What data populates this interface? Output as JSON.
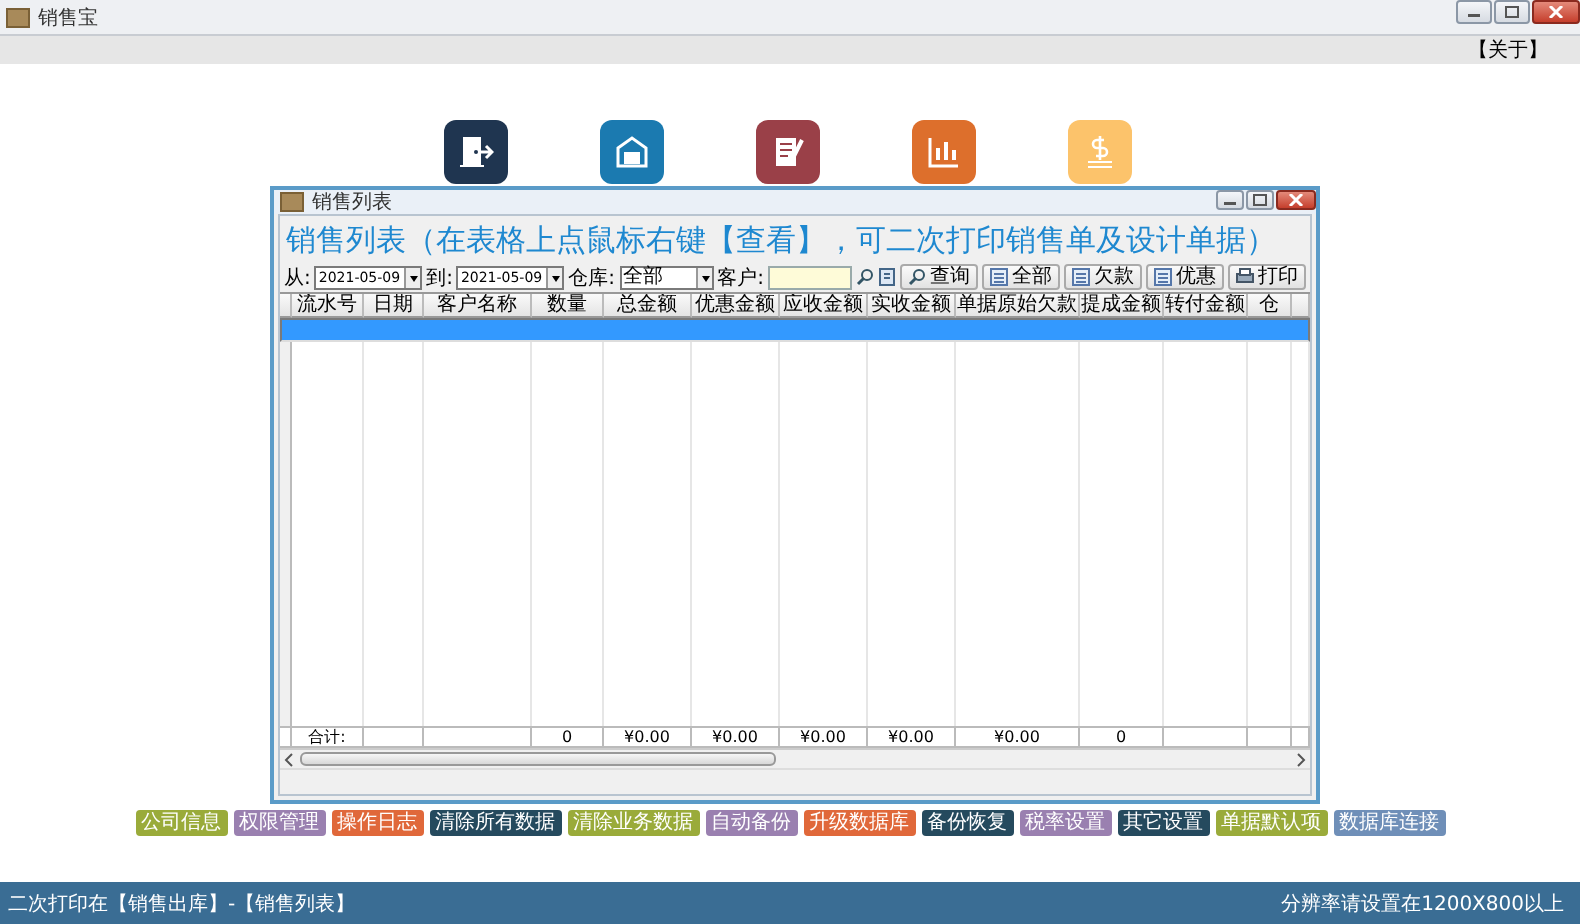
{
  "app": {
    "title": "销售宝",
    "about": "【关于】"
  },
  "tiles": [
    {
      "kind": "exit",
      "color": "#1f3550"
    },
    {
      "kind": "warehouse",
      "color": "#1b7ab0"
    },
    {
      "kind": "document",
      "color": "#9a4048"
    },
    {
      "kind": "chart",
      "color": "#dd6f2c"
    },
    {
      "kind": "money",
      "color": "#fcc36b"
    }
  ],
  "sales_window": {
    "title": "销售列表",
    "heading": "销售列表（在表格上点鼠标右键【查看】，可二次打印销售单及设计单据）",
    "filters": {
      "from_label": "从:",
      "from_date": "2021-05-09",
      "to_label": "到:",
      "to_date": "2021-05-09",
      "warehouse_label": "仓库:",
      "warehouse": "全部",
      "customer_label": "客户:"
    },
    "buttons": [
      {
        "label": "查询",
        "kind": "search"
      },
      {
        "label": "全部",
        "kind": "list"
      },
      {
        "label": "欠款",
        "kind": "list"
      },
      {
        "label": "优惠",
        "kind": "list"
      },
      {
        "label": "打印",
        "kind": "print"
      }
    ],
    "table": {
      "columns": [
        "流水号",
        "日期",
        "客户名称",
        "数量",
        "总金额",
        "优惠金额",
        "应收金额",
        "实收金额",
        "单据原始欠款",
        "提成金额",
        "转付金额",
        "仓"
      ],
      "rows": [
        {
          "selected": true
        }
      ],
      "totals": {
        "label": "合计:",
        "quantity": "0",
        "total_amount": "¥0.00",
        "discount_amount": "¥0.00",
        "receivable": "¥0.00",
        "received": "¥0.00",
        "original_debt": "¥0.00",
        "commission": "0"
      }
    }
  },
  "actions": [
    {
      "label": "公司信息",
      "color": "#9aab3a"
    },
    {
      "label": "权限管理",
      "color": "#9a80b0"
    },
    {
      "label": "操作日志",
      "color": "#e0683a"
    },
    {
      "label": "清除所有数据",
      "color": "#254a5e"
    },
    {
      "label": "清除业务数据",
      "color": "#9aab3a"
    },
    {
      "label": "自动备份",
      "color": "#9a80b0"
    },
    {
      "label": "升级数据库",
      "color": "#e0683a"
    },
    {
      "label": "备份恢复",
      "color": "#254a5e"
    },
    {
      "label": "税率设置",
      "color": "#9a80b0"
    },
    {
      "label": "其它设置",
      "color": "#254a5e"
    },
    {
      "label": "单据默认项",
      "color": "#9aab3a"
    },
    {
      "label": "数据库连接",
      "color": "#6f8fb8"
    }
  ],
  "status_bar": {
    "left": "二次打印在【销售出库】-【销售列表】",
    "right": "分辨率请设置在1200X800以上"
  }
}
